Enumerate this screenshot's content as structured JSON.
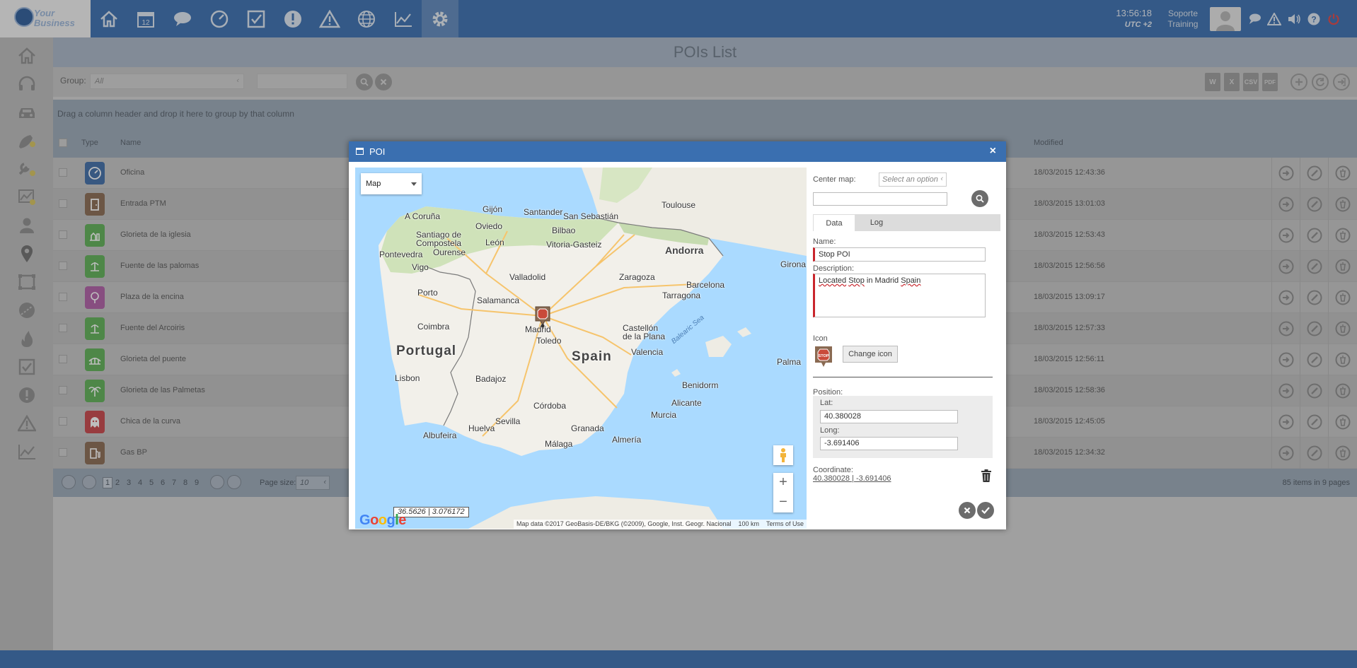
{
  "app": {
    "logo_line1": "Your",
    "logo_line2": "Business"
  },
  "topbar": {
    "nav_icons": [
      "home-icon",
      "calendar-icon",
      "chat-icon",
      "dashboard-icon",
      "checklist-icon",
      "alert-icon",
      "warning-icon",
      "globe-icon",
      "chart-icon",
      "gear-icon"
    ],
    "calendar_day": "12",
    "time": "13:56:18",
    "timezone": "UTC +2",
    "user_line1": "Soporte",
    "user_line2": "Training",
    "right_icons": [
      "messages-icon",
      "warning-icon",
      "volume-icon",
      "help-icon",
      "power-icon"
    ]
  },
  "sidebar": {
    "icons": [
      "home-icon",
      "headset-icon",
      "car-icon",
      "satellite-icon",
      "tools-icon",
      "map-chart-icon",
      "user-icon",
      "location-pin-icon",
      "layers-icon",
      "road-icon",
      "fire-icon",
      "checklist-icon",
      "alert-icon",
      "warning-icon",
      "chart-icon"
    ]
  },
  "page": {
    "title": "POIs List"
  },
  "filter": {
    "group_label": "Group:",
    "group_value": "All",
    "export_labels": [
      "W",
      "X",
      "CSV",
      "PDF"
    ]
  },
  "grid": {
    "group_hint": "Drag a column header and drop it here to group by that column",
    "columns": {
      "type": "Type",
      "name": "Name",
      "modified": "Modified"
    },
    "rows": [
      {
        "name": "Oficina",
        "modified": "18/03/2015 12:43:36",
        "icon": "office-icon",
        "color": "#3f6ea8"
      },
      {
        "name": "Entrada PTM",
        "modified": "18/03/2015 13:01:03",
        "icon": "door-icon",
        "color": "#8a6a52"
      },
      {
        "name": "Glorieta de la iglesia",
        "modified": "18/03/2015 12:53:43",
        "icon": "roundabout-icon",
        "color": "#5fb157"
      },
      {
        "name": "Fuente de las palomas",
        "modified": "18/03/2015 12:56:56",
        "icon": "fountain-icon",
        "color": "#5fb157"
      },
      {
        "name": "Plaza de la encina",
        "modified": "18/03/2015 13:09:17",
        "icon": "tree-icon",
        "color": "#b05fa6"
      },
      {
        "name": "Fuente del Arcoiris",
        "modified": "18/03/2015 12:57:33",
        "icon": "fountain-icon",
        "color": "#5fb157"
      },
      {
        "name": "Glorieta del puente",
        "modified": "18/03/2015 12:56:11",
        "icon": "bridge-icon",
        "color": "#5fb157"
      },
      {
        "name": "Glorieta de las Palmetas",
        "modified": "18/03/2015 12:58:36",
        "icon": "palm-icon",
        "color": "#5fb157"
      },
      {
        "name": "Chica de la curva",
        "modified": "18/03/2015 12:45:05",
        "icon": "ghost-icon",
        "color": "#c9454a"
      },
      {
        "name": "Gas BP",
        "modified": "18/03/2015 12:34:32",
        "icon": "fuel-icon",
        "color": "#8a6a52"
      }
    ]
  },
  "pager": {
    "pages": [
      "1",
      "2",
      "3",
      "4",
      "5",
      "6",
      "7",
      "8",
      "9"
    ],
    "current_page": "1",
    "page_size_label": "Page size:",
    "page_size": "10",
    "items_info": "85 items in 9 pages"
  },
  "dialog": {
    "title": "POI",
    "close": "×",
    "map": {
      "type_label": "Map",
      "coord_readout": "36.5626 | 3.076172",
      "google": "Google",
      "attribution": "Map data ©2017 GeoBasis-DE/BKG (©2009), Google, Inst. Geogr. Nacional",
      "scale": "100 km",
      "terms": "Terms of Use",
      "labels": {
        "gijon": "Gijón",
        "santander": "Santander",
        "san_sebastian": "San Sebastián",
        "toulouse": "Toulouse",
        "a_coruna": "A Coruña",
        "oviedo": "Oviedo",
        "bilbao": "Bilbao",
        "santiago1": "Santiago de",
        "santiago2": "Compostela",
        "leon": "León",
        "vitoria": "Vitoria-Gasteiz",
        "andorra": "Andorra",
        "pontevedra": "Pontevedra",
        "ourense": "Ourense",
        "girona": "Girona",
        "vigo": "Vigo",
        "valladolid": "Valladolid",
        "zaragoza": "Zaragoza",
        "barcelona": "Barcelona",
        "porto": "Porto",
        "salamanca": "Salamanca",
        "tarragona": "Tarragona",
        "madrid": "Madrid",
        "coimbra": "Coimbra",
        "castellon1": "Castellón",
        "castellon2": "de la Plana",
        "balearic": "Balearic Sea",
        "portugal": "Portugal",
        "toledo": "Toledo",
        "spain": "Spain",
        "valencia": "Valencia",
        "palma": "Palma",
        "lisbon": "Lisbon",
        "badajoz": "Badajoz",
        "benidorm": "Benidorm",
        "alicante": "Alicante",
        "cordoba": "Córdoba",
        "murcia": "Murcia",
        "sevilla": "Sevilla",
        "huelva": "Huelva",
        "granada": "Granada",
        "albufeira": "Albufeira",
        "malaga": "Málaga",
        "almeria": "Almería"
      }
    },
    "panel": {
      "center_map_label": "Center map:",
      "center_map_placeholder": "Select an option",
      "tabs": [
        "Data",
        "Log"
      ],
      "name_label": "Name:",
      "name_value": "Stop POI",
      "description_label": "Description:",
      "description_words": [
        "Located",
        "Stop",
        "in",
        "Madrid",
        "Spain"
      ],
      "icon_label": "Icon",
      "icon_text": "STOP",
      "change_icon": "Change icon",
      "position_label": "Position:",
      "lat_label": "Lat:",
      "lat_value": "40.380028",
      "long_label": "Long:",
      "long_value": "-3.691406",
      "coordinate_label": "Coordinate:",
      "coordinate_value": "40.380028 | -3.691406"
    }
  }
}
